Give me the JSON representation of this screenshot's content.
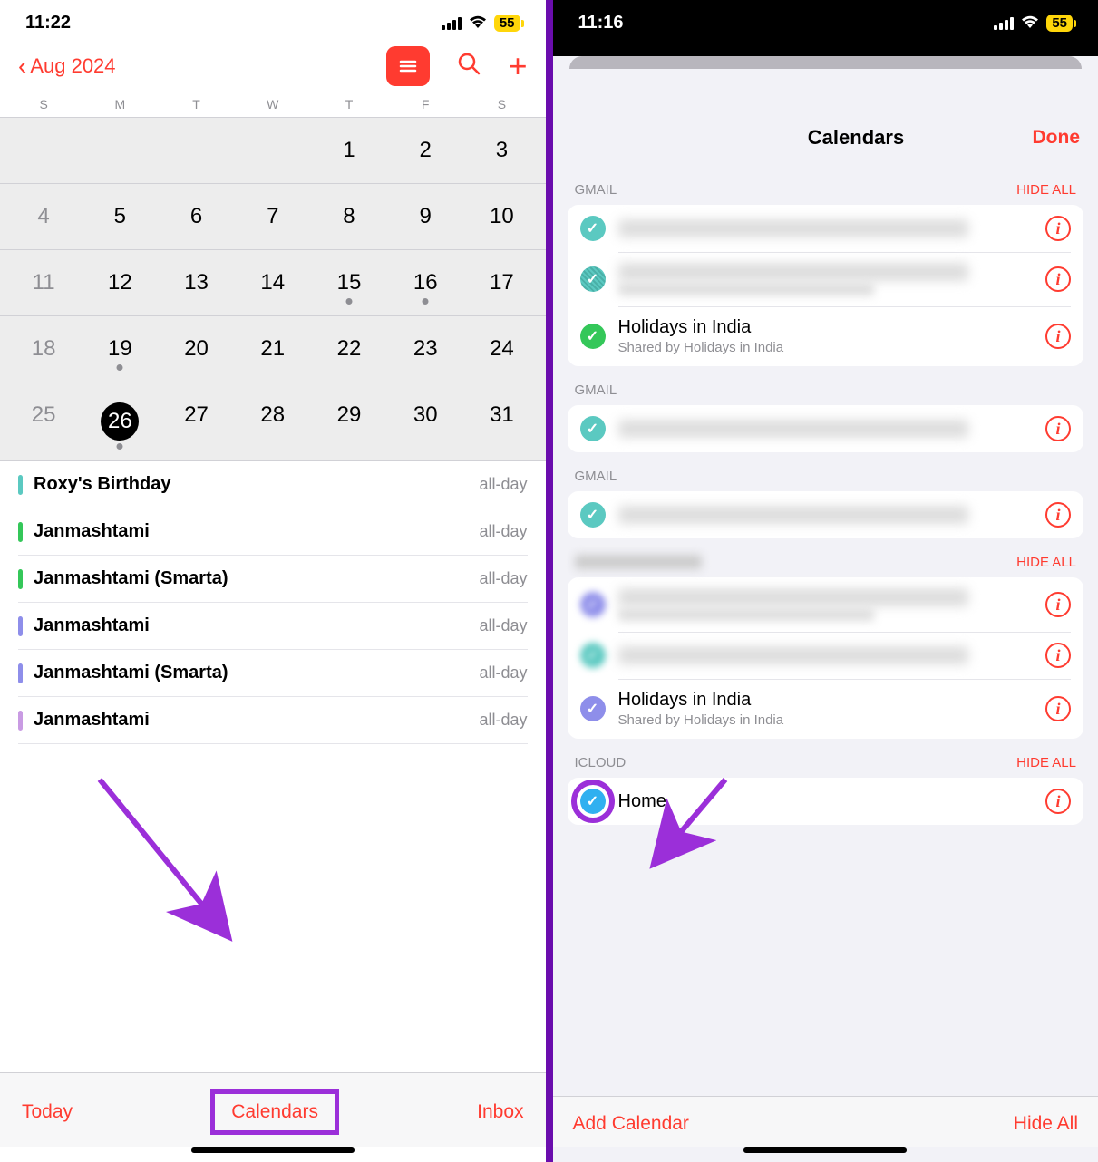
{
  "left": {
    "status": {
      "time": "11:22",
      "battery": "55"
    },
    "header": {
      "back_label": "Aug 2024"
    },
    "days": [
      "S",
      "M",
      "T",
      "W",
      "T",
      "F",
      "S"
    ],
    "grid": [
      [
        {
          "n": ""
        },
        {
          "n": ""
        },
        {
          "n": ""
        },
        {
          "n": ""
        },
        {
          "n": "1"
        },
        {
          "n": "2"
        },
        {
          "n": "3"
        }
      ],
      [
        {
          "n": "4",
          "dim": true
        },
        {
          "n": "5"
        },
        {
          "n": "6"
        },
        {
          "n": "7"
        },
        {
          "n": "8"
        },
        {
          "n": "9"
        },
        {
          "n": "10"
        }
      ],
      [
        {
          "n": "11",
          "dim": true
        },
        {
          "n": "12"
        },
        {
          "n": "13"
        },
        {
          "n": "14"
        },
        {
          "n": "15",
          "dot": true
        },
        {
          "n": "16",
          "dot": true
        },
        {
          "n": "17"
        }
      ],
      [
        {
          "n": "18",
          "dim": true
        },
        {
          "n": "19",
          "dot": true
        },
        {
          "n": "20"
        },
        {
          "n": "21"
        },
        {
          "n": "22"
        },
        {
          "n": "23"
        },
        {
          "n": "24"
        }
      ],
      [
        {
          "n": "25",
          "dim": true
        },
        {
          "n": "26",
          "today": true,
          "dot": true
        },
        {
          "n": "27"
        },
        {
          "n": "28"
        },
        {
          "n": "29"
        },
        {
          "n": "30"
        },
        {
          "n": "31"
        }
      ]
    ],
    "events": [
      {
        "title": "Roxy's Birthday",
        "time": "all-day",
        "color": "#5bc9c1"
      },
      {
        "title": "Janmashtami",
        "time": "all-day",
        "color": "#34c759"
      },
      {
        "title": "Janmashtami (Smarta)",
        "time": "all-day",
        "color": "#34c759"
      },
      {
        "title": "Janmashtami",
        "time": "all-day",
        "color": "#8e8eea"
      },
      {
        "title": "Janmashtami (Smarta)",
        "time": "all-day",
        "color": "#8e8eea"
      },
      {
        "title": "Janmashtami",
        "time": "all-day",
        "color": "#c99be3"
      }
    ],
    "toolbar": {
      "today": "Today",
      "calendars": "Calendars",
      "inbox": "Inbox"
    }
  },
  "right": {
    "status": {
      "time": "11:16",
      "battery": "55"
    },
    "modal": {
      "title": "Calendars",
      "done": "Done"
    },
    "sections": [
      {
        "header": "GMAIL",
        "hide": "HIDE ALL",
        "items": [
          {
            "check": "teal",
            "blurred": true
          },
          {
            "check": "teal-patt",
            "blurred": true,
            "sub": true
          },
          {
            "check": "green",
            "title": "Holidays in India",
            "sub": "Shared by Holidays in India"
          }
        ]
      },
      {
        "header": "GMAIL",
        "items": [
          {
            "check": "teal",
            "blurred": true
          }
        ]
      },
      {
        "header": "GMAIL",
        "items": [
          {
            "check": "teal",
            "blurred": true
          }
        ]
      },
      {
        "header": "",
        "hide": "HIDE ALL",
        "blur_header": true,
        "items": [
          {
            "check": "purple",
            "check_blur": true,
            "blurred": true,
            "sub": true
          },
          {
            "check": "teal",
            "check_blur": true,
            "blurred": true
          },
          {
            "check": "purple",
            "title": "Holidays in India",
            "sub": "Shared by Holidays in India"
          }
        ]
      },
      {
        "header": "ICLOUD",
        "hide": "HIDE ALL",
        "items": [
          {
            "check": "blue",
            "title": "Home",
            "highlight": true
          }
        ]
      }
    ],
    "toolbar": {
      "add": "Add Calendar",
      "hide": "Hide All"
    }
  }
}
